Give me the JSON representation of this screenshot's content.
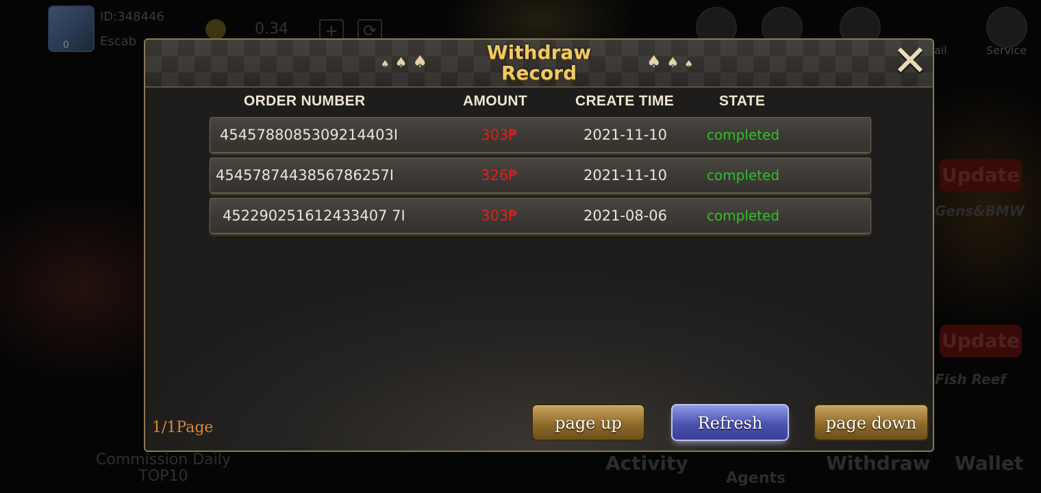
{
  "background": {
    "user_id": "ID:348446",
    "user_name": "Escab",
    "vip_level": "0",
    "balance": "0.34",
    "top_labels": [
      "ail",
      "Service"
    ],
    "side_labels": [
      "Update",
      "Gens&BMW",
      "Update",
      "Fish Reef"
    ],
    "bottom_labels": [
      "Commission Daily",
      "TOP10",
      "Activity",
      "Agents",
      "Withdraw",
      "Wallet"
    ]
  },
  "modal": {
    "title_line1": "Withdraw",
    "title_line2": "Record",
    "close_icon": "close-x-icon",
    "columns": [
      "ORDER NUMBER",
      "AMOUNT",
      "CREATE TIME",
      "STATE"
    ],
    "rows": [
      {
        "order": "4545788085309214403I",
        "amount": "303₱",
        "time": "2021-11-10",
        "state": "completed"
      },
      {
        "order": "4545787443856786257I",
        "amount": "326₱",
        "time": "2021-11-10",
        "state": "completed"
      },
      {
        "order": "452290251612433407 7I",
        "amount": "303₱",
        "time": "2021-08-06",
        "state": "completed"
      }
    ],
    "page_info": "1/1Page",
    "buttons": {
      "page_up": "page up",
      "refresh": "Refresh",
      "page_down": "page down"
    }
  },
  "colors": {
    "title": "#f0c964",
    "amount": "#e0201c",
    "state": "#2ec225",
    "page_info": "#d98a3a",
    "refresh_button": "#4a53b0",
    "gold_button": "#8f6a2a"
  }
}
